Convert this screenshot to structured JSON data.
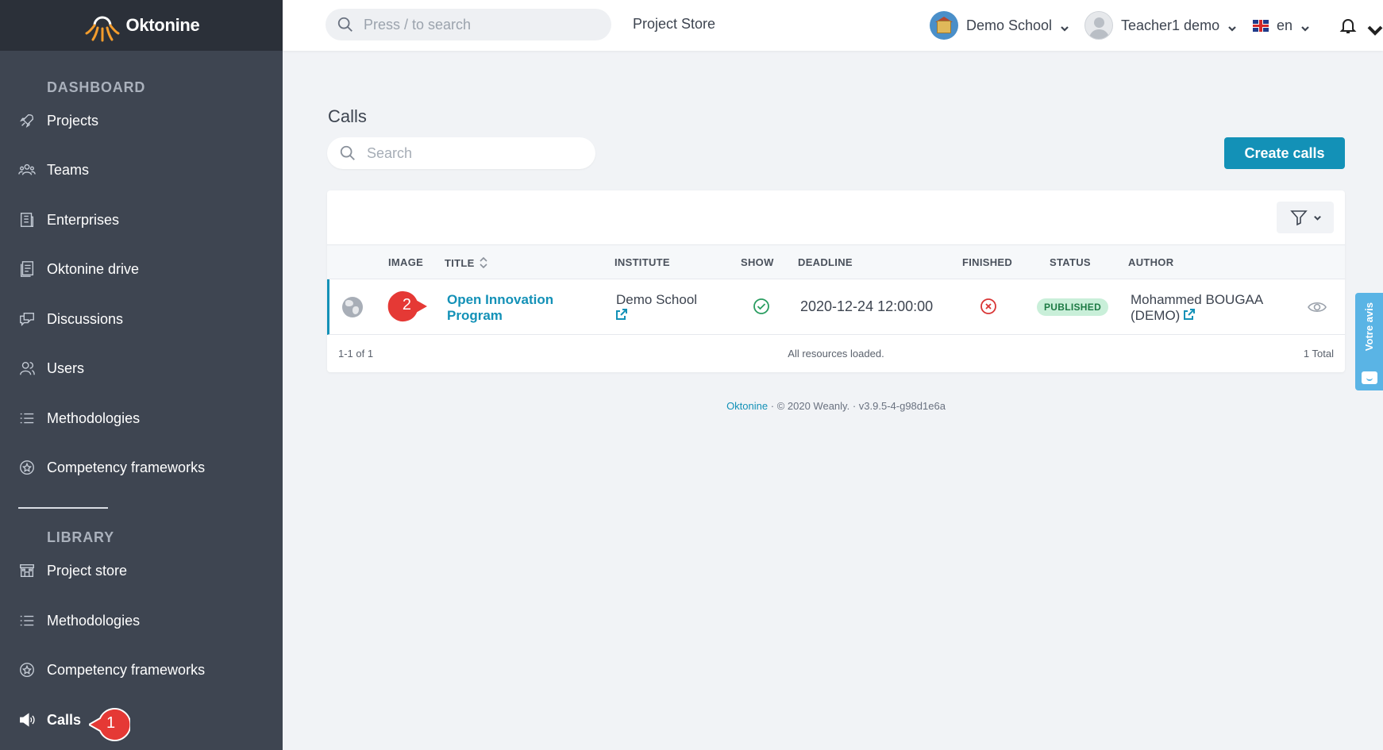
{
  "brand": {
    "name": "Oktonine"
  },
  "topbar": {
    "search_placeholder": "Press / to search",
    "project_store": "Project Store",
    "school": "Demo School",
    "user": "Teacher1 demo",
    "lang": "en"
  },
  "sidebar": {
    "dashboard_title": "DASHBOARD",
    "library_title": "LIBRARY",
    "dashboard_items": [
      {
        "label": "Projects",
        "icon": "rocket-icon"
      },
      {
        "label": "Teams",
        "icon": "team-icon"
      },
      {
        "label": "Enterprises",
        "icon": "enterprise-icon"
      },
      {
        "label": "Oktonine drive",
        "icon": "drive-icon"
      },
      {
        "label": "Discussions",
        "icon": "discussion-icon"
      },
      {
        "label": "Users",
        "icon": "users-icon"
      },
      {
        "label": "Methodologies",
        "icon": "list-icon"
      },
      {
        "label": "Competency frameworks",
        "icon": "badge-icon"
      }
    ],
    "library_items": [
      {
        "label": "Project store",
        "icon": "store-icon"
      },
      {
        "label": "Methodologies",
        "icon": "list-icon"
      },
      {
        "label": "Competency frameworks",
        "icon": "badge-icon"
      },
      {
        "label": "Calls",
        "icon": "megaphone-icon"
      }
    ]
  },
  "main": {
    "title": "Calls",
    "search_placeholder": "Search",
    "create_button": "Create calls",
    "table": {
      "columns": [
        "IMAGE",
        "TITLE",
        "INSTITUTE",
        "SHOW",
        "DEADLINE",
        "FINISHED",
        "STATUS",
        "AUTHOR"
      ],
      "rows": [
        {
          "title_line1": "Open Innovation",
          "title_line2": "Program",
          "institute": "Demo School",
          "deadline": "2020-12-24 12:00:00",
          "status": "PUBLISHED",
          "author_line1": "Mohammed BOUGAA",
          "author_line2": "(DEMO)"
        }
      ],
      "range": "1-1 of 1",
      "loaded": "All resources loaded.",
      "total": "1 Total"
    }
  },
  "footer": {
    "brand": "Oktonine",
    "sep1": "·",
    "copyright": "© 2020 Weanly.",
    "sep2": "·",
    "version": "v3.9.5-4-g98d1e6a"
  },
  "feedback": {
    "label": "Votre avis"
  },
  "callouts": {
    "one": "1",
    "two": "2"
  },
  "colors": {
    "accent": "#1391b7",
    "sidebar": "#3e4551",
    "brand_bar": "#2b3039",
    "published_bg": "#c9efd9",
    "callout": "#e53935"
  }
}
